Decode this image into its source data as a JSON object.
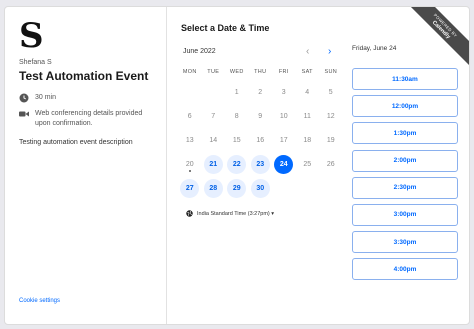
{
  "sidebar": {
    "logo": "S",
    "host": "Shefana S",
    "title": "Test Automation Event",
    "duration": "30 min",
    "location": "Web conferencing details provided upon confirmation.",
    "description": "Testing automation event description",
    "cookie_settings": "Cookie settings"
  },
  "scheduler": {
    "heading": "Select a Date & Time",
    "month": "June 2022",
    "prev_icon": "chevron-left-icon",
    "next_icon": "chevron-right-icon",
    "weekdays": [
      "MON",
      "TUE",
      "WED",
      "THU",
      "FRI",
      "SAT",
      "SUN"
    ],
    "days": [
      {
        "d": "",
        "s": "empty"
      },
      {
        "d": "",
        "s": "empty"
      },
      {
        "d": "1",
        "s": "off"
      },
      {
        "d": "2",
        "s": "off"
      },
      {
        "d": "3",
        "s": "off"
      },
      {
        "d": "4",
        "s": "off"
      },
      {
        "d": "5",
        "s": "off"
      },
      {
        "d": "6",
        "s": "off"
      },
      {
        "d": "7",
        "s": "off"
      },
      {
        "d": "8",
        "s": "off"
      },
      {
        "d": "9",
        "s": "off"
      },
      {
        "d": "10",
        "s": "off"
      },
      {
        "d": "11",
        "s": "off"
      },
      {
        "d": "12",
        "s": "off"
      },
      {
        "d": "13",
        "s": "off"
      },
      {
        "d": "14",
        "s": "off"
      },
      {
        "d": "15",
        "s": "off"
      },
      {
        "d": "16",
        "s": "off"
      },
      {
        "d": "17",
        "s": "off"
      },
      {
        "d": "18",
        "s": "off"
      },
      {
        "d": "19",
        "s": "off"
      },
      {
        "d": "20",
        "s": "today"
      },
      {
        "d": "21",
        "s": "avail"
      },
      {
        "d": "22",
        "s": "avail"
      },
      {
        "d": "23",
        "s": "avail"
      },
      {
        "d": "24",
        "s": "sel"
      },
      {
        "d": "25",
        "s": "off"
      },
      {
        "d": "26",
        "s": "off"
      },
      {
        "d": "27",
        "s": "avail"
      },
      {
        "d": "28",
        "s": "avail"
      },
      {
        "d": "29",
        "s": "avail"
      },
      {
        "d": "30",
        "s": "avail"
      },
      {
        "d": "",
        "s": "empty"
      },
      {
        "d": "",
        "s": "empty"
      },
      {
        "d": "",
        "s": "empty"
      }
    ],
    "timezone": "India Standard Time (3:27pm) ▾"
  },
  "times": {
    "date_label": "Friday, June 24",
    "slots": [
      "11:30am",
      "12:00pm",
      "1:30pm",
      "2:00pm",
      "2:30pm",
      "3:00pm",
      "3:30pm",
      "4:00pm"
    ]
  },
  "ribbon": {
    "line1": "POWERED BY",
    "line2": "Calendly"
  },
  "colors": {
    "accent": "#0069ff",
    "available_bg": "#e6efff"
  }
}
